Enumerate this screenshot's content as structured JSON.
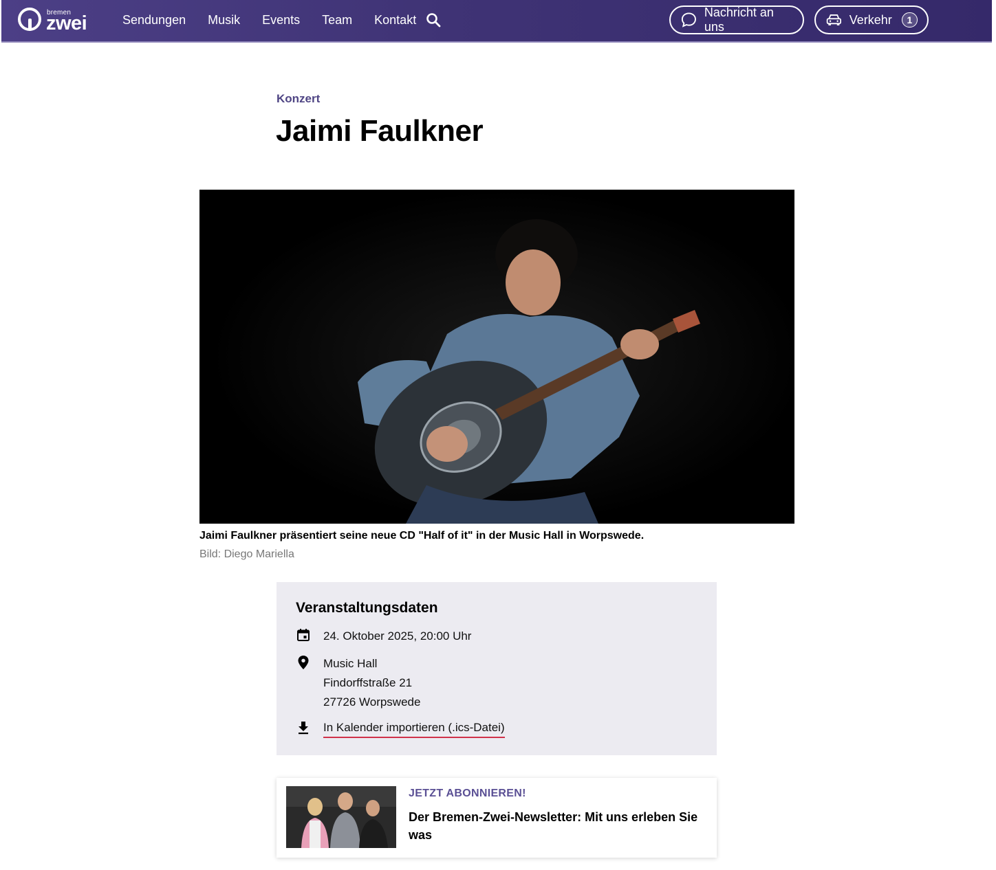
{
  "header": {
    "logo_small": "bremen",
    "logo_big": "zwei",
    "nav": [
      "Sendungen",
      "Musik",
      "Events",
      "Team",
      "Kontakt"
    ],
    "message_button": "Nachricht an uns",
    "traffic_button": "Verkehr",
    "traffic_count": "1"
  },
  "article": {
    "kicker": "Konzert",
    "title": "Jaimi Faulkner",
    "caption": "Jaimi Faulkner präsentiert seine neue CD \"Half of it\" in der Music Hall in Worpswede.",
    "credit": "Bild: Diego Mariella"
  },
  "event": {
    "heading": "Veranstaltungsdaten",
    "date": "24. Oktober 2025, 20:00 Uhr",
    "venue": "Music Hall",
    "street": "Findorffstraße 21",
    "city": "27726 Worpswede",
    "ics_link": "In Kalender importieren (.ics-Datei)"
  },
  "teaser": {
    "kicker": "JETZT ABONNIEREN!",
    "title": "Der Bremen-Zwei-Newsletter: Mit uns erleben Sie was"
  },
  "colors": {
    "header_bg": "#3f3375",
    "accent": "#4f4584",
    "link_underline": "#d0314a",
    "event_box_bg": "#ecebf1"
  }
}
